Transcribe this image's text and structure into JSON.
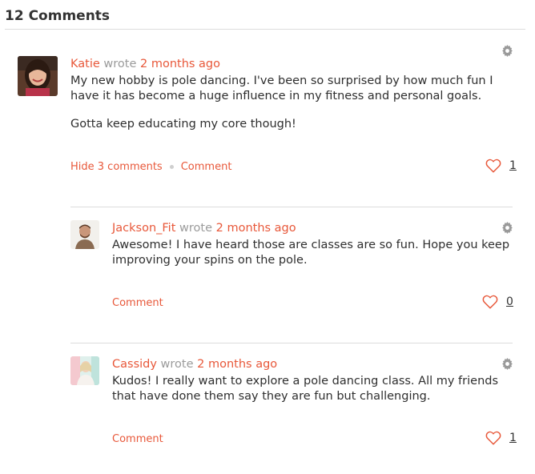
{
  "header": {
    "title": "12 Comments"
  },
  "colors": {
    "accent": "#e8583a",
    "muted": "#9b9b9b",
    "divider": "#dcdcdc"
  },
  "comments": [
    {
      "author": "Katie",
      "wrote": "wrote",
      "time": "2 months ago",
      "paragraphs": [
        "My new hobby is pole dancing. I've been so surprised by how much fun I have it has become a huge influence in my fitness and personal goals.",
        "Gotta keep educating my core though!"
      ],
      "hide_label": "Hide 3 comments",
      "comment_label": "Comment",
      "likes": "1"
    },
    {
      "author": "Jackson_Fit",
      "wrote": "wrote",
      "time": "2 months ago",
      "paragraphs": [
        "Awesome! I have heard those are classes are so fun. Hope you keep improving your spins on the pole."
      ],
      "comment_label": "Comment",
      "likes": "0"
    },
    {
      "author": "Cassidy",
      "wrote": "wrote",
      "time": "2 months ago",
      "paragraphs": [
        "Kudos! I really want to explore a pole dancing class. All my friends that have done them say they are fun but challenging."
      ],
      "comment_label": "Comment",
      "likes": "1"
    }
  ]
}
